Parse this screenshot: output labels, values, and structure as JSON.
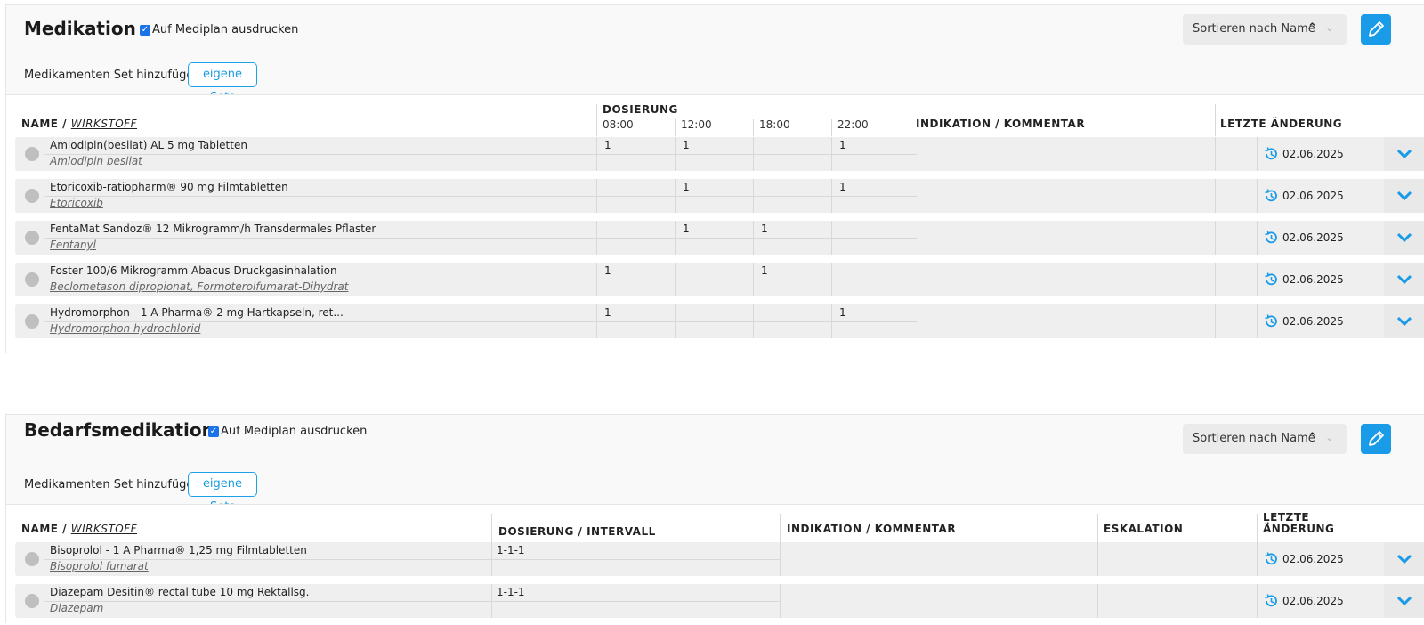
{
  "medikation": {
    "title": "Medikation",
    "print_label": "Auf Mediplan ausdrucken",
    "print_checked": true,
    "set_label": "Medikamenten Set hinzufügen",
    "set_button": "eigene Sets",
    "sort_label": "Sortieren nach Name",
    "headers": {
      "name": "NAME /",
      "wirkstoff": "WIRKSTOFF",
      "dosierung": "DOSIERUNG",
      "times": [
        "08:00",
        "12:00",
        "18:00",
        "22:00"
      ],
      "indikation": "INDIKATION / KOMMENTAR",
      "letzte": "LETZTE ÄNDERUNG"
    },
    "rows": [
      {
        "name": "Amlodipin(besilat) AL 5 mg Tabletten",
        "wirkstoff": "Amlodipin besilat",
        "doses": [
          "1",
          "1",
          "",
          "1"
        ],
        "date": "02.06.2025"
      },
      {
        "name": "Etoricoxib-ratiopharm® 90 mg Filmtabletten",
        "wirkstoff": "Etoricoxib",
        "doses": [
          "",
          "1",
          "",
          "1"
        ],
        "date": "02.06.2025"
      },
      {
        "name": "FentaMat Sandoz® 12 Mikrogramm/h Transdermales Pflaster",
        "wirkstoff": "Fentanyl",
        "doses": [
          "",
          "1",
          "1",
          ""
        ],
        "date": "02.06.2025"
      },
      {
        "name": "Foster 100/6 Mikrogramm Abacus Druckgasinhalation",
        "wirkstoff": "Beclometason dipropionat, Formoterolfumarat-Dihydrat",
        "doses": [
          "1",
          "",
          "1",
          ""
        ],
        "date": "02.06.2025"
      },
      {
        "name": "Hydromorphon - 1 A Pharma® 2 mg Hartkapseln, ret...",
        "wirkstoff": "Hydromorphon hydrochlorid",
        "doses": [
          "1",
          "",
          "",
          "1"
        ],
        "date": "02.06.2025"
      }
    ]
  },
  "bedarf": {
    "title": "Bedarfsmedikation",
    "print_label": "Auf Mediplan ausdrucken",
    "print_checked": true,
    "set_label": "Medikamenten Set hinzufügen",
    "set_button": "eigene Sets",
    "sort_label": "Sortieren nach Name",
    "headers": {
      "name": "NAME /",
      "wirkstoff": "WIRKSTOFF",
      "dosierung": "DOSIERUNG / INTERVALL",
      "indikation": "INDIKATION / KOMMENTAR",
      "eskalation": "ESKALATION",
      "letzte_1": "LETZTE",
      "letzte_2": "ÄNDERUNG"
    },
    "rows": [
      {
        "name": "Bisoprolol - 1 A Pharma® 1,25 mg Filmtabletten",
        "wirkstoff": "Bisoprolol fumarat",
        "dose": "1-1-1",
        "date": "02.06.2025"
      },
      {
        "name": "Diazepam Desitin® rectal tube 10 mg Rektallsg.",
        "wirkstoff": "Diazepam",
        "dose": "1-1-1",
        "date": "02.06.2025"
      }
    ]
  },
  "icons": {
    "sort_up": "chevron-up-icon",
    "sort_down": "chevron-down-icon",
    "edit": "pencil-icon",
    "history": "history-icon",
    "expand": "chevron-down-icon",
    "status": "status-dot-icon"
  },
  "colors": {
    "accent": "#1a9be8",
    "row_bg": "#efefef"
  }
}
